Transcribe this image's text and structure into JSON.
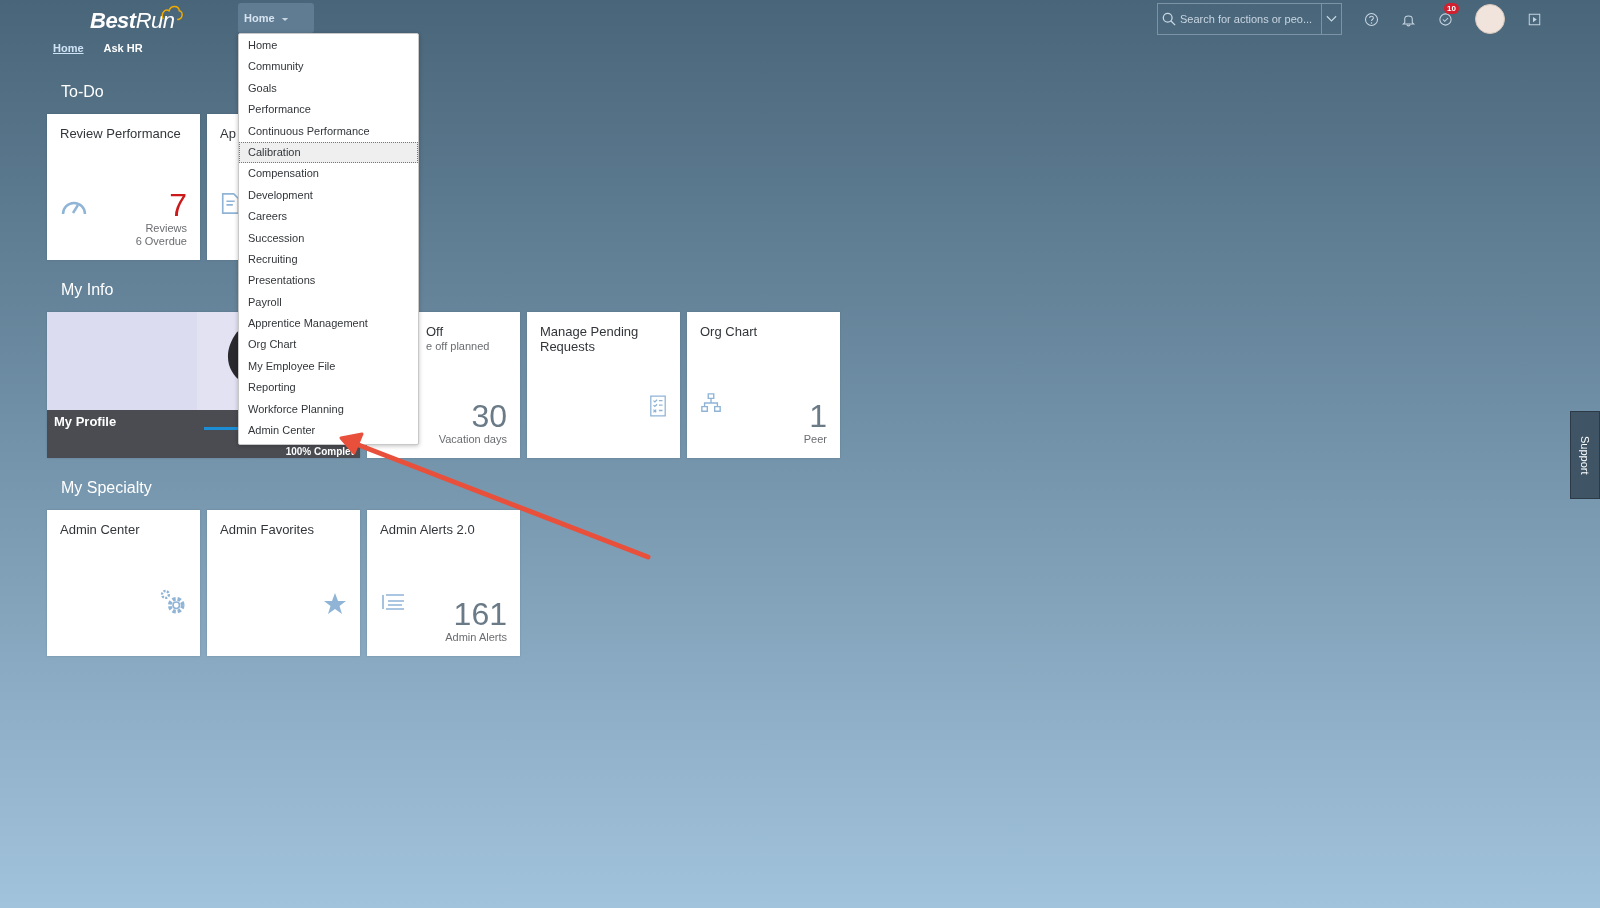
{
  "header": {
    "logo": "**Best**Run",
    "nav": [
      {
        "label": "Home",
        "selected": true
      },
      {
        "label": "Ask HR",
        "selected": false
      }
    ],
    "menu_button": "Home",
    "search": {
      "placeholder": "Search for actions or peo..."
    },
    "notification_badge": "10"
  },
  "menu": {
    "items": [
      {
        "label": "Home",
        "selected": false
      },
      {
        "label": "Community",
        "selected": false
      },
      {
        "label": "Goals",
        "selected": false
      },
      {
        "label": "Performance",
        "selected": false
      },
      {
        "label": "Continuous Performance",
        "selected": false
      },
      {
        "label": "Calibration",
        "selected": true
      },
      {
        "label": "Compensation",
        "selected": false
      },
      {
        "label": "Development",
        "selected": false
      },
      {
        "label": "Careers",
        "selected": false
      },
      {
        "label": "Succession",
        "selected": false
      },
      {
        "label": "Recruiting",
        "selected": false
      },
      {
        "label": "Presentations",
        "selected": false
      },
      {
        "label": "Payroll",
        "selected": false
      },
      {
        "label": "Apprentice Management",
        "selected": false
      },
      {
        "label": "Org Chart",
        "selected": false
      },
      {
        "label": "My Employee File",
        "selected": false
      },
      {
        "label": "Reporting",
        "selected": false
      },
      {
        "label": "Workforce Planning",
        "selected": false
      },
      {
        "label": "Admin Center",
        "selected": false
      }
    ]
  },
  "sections": [
    {
      "title": "To-Do",
      "tiles": [
        {
          "kind": "count",
          "title": "Review Performance",
          "number": "7",
          "critical": true,
          "footer": [
            "Reviews",
            "6 Overdue"
          ]
        },
        {
          "kind": "partial",
          "title": "Ap"
        }
      ]
    },
    {
      "title": "My Info",
      "tiles": [
        {
          "kind": "profile",
          "title": "My Profile",
          "progress": {
            "level": 1,
            "label": "100% Complet"
          }
        },
        {
          "kind": "count",
          "title": "Off",
          "subtitle": "e off planned",
          "number": "30",
          "critical": false,
          "footer": [
            "Vacation days"
          ],
          "cut": true
        },
        {
          "kind": "icon",
          "title": "Manage Pending Requests"
        },
        {
          "kind": "count",
          "title": "Org Chart",
          "number": "1",
          "critical": false,
          "footer": [
            "Peer"
          ]
        }
      ]
    },
    {
      "title": "My Specialty",
      "tiles": [
        {
          "kind": "icon",
          "title": "Admin Center"
        },
        {
          "kind": "icon",
          "title": "Admin Favorites"
        },
        {
          "kind": "count",
          "title": "Admin Alerts 2.0",
          "number": "161",
          "critical": false,
          "footer": [
            "Admin Alerts"
          ]
        }
      ]
    }
  ],
  "support_tab": "Support"
}
